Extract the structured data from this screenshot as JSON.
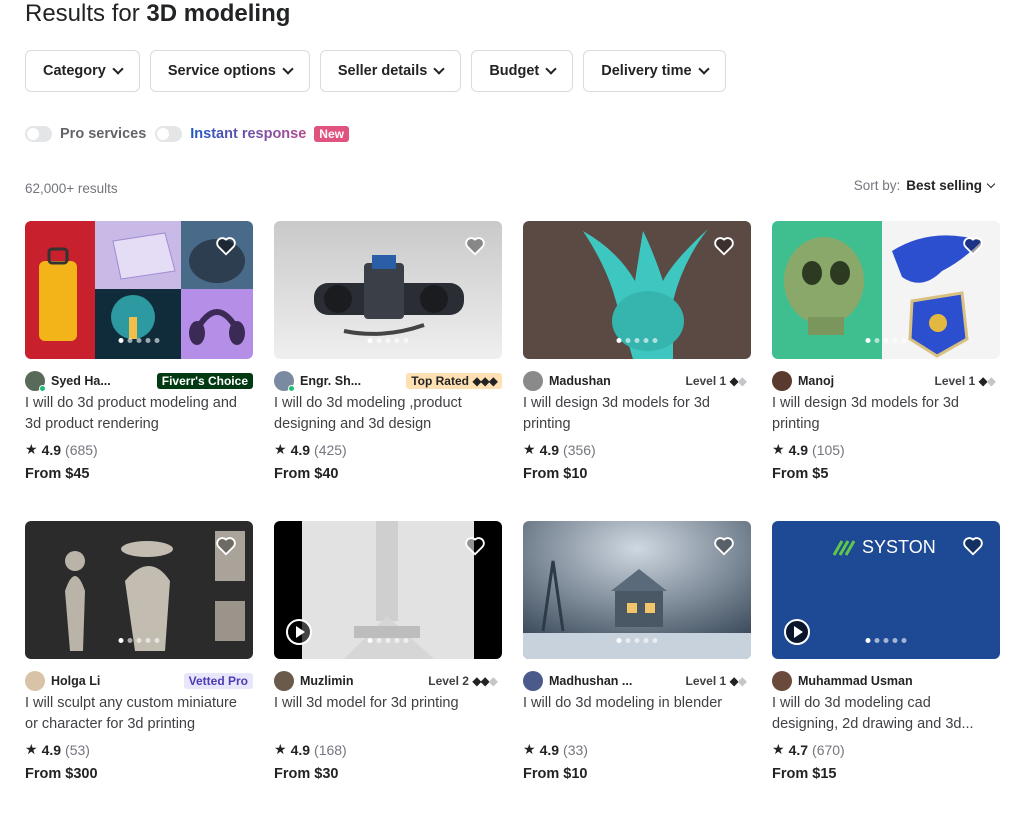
{
  "header": {
    "prefix": "Results for",
    "query": "3D modeling"
  },
  "filters": [
    "Category",
    "Service options",
    "Seller details",
    "Budget",
    "Delivery time"
  ],
  "toggles": {
    "pro": "Pro services",
    "instant": "Instant response",
    "new_badge": "New"
  },
  "results_count": "62,000+ results",
  "sort": {
    "label": "Sort by:",
    "value": "Best selling"
  },
  "gigs": [
    {
      "seller": "Syed Ha...",
      "badge": "Fiverr's Choice",
      "title": "I will do 3d product modeling and 3d product rendering",
      "rating": "4.9",
      "reviews": "(685)",
      "price": "From $45"
    },
    {
      "seller": "Engr. Sh...",
      "badge": "Top Rated",
      "title": "I will do 3d modeling ,product designing and 3d design",
      "rating": "4.9",
      "reviews": "(425)",
      "price": "From $40"
    },
    {
      "seller": "Madushan",
      "badge": "Level 1",
      "title": "I will design 3d models for 3d printing",
      "rating": "4.9",
      "reviews": "(356)",
      "price": "From $10"
    },
    {
      "seller": "Manoj",
      "badge": "Level 1",
      "title": "I will design 3d models for 3d printing",
      "rating": "4.9",
      "reviews": "(105)",
      "price": "From $5"
    },
    {
      "seller": "Holga Li",
      "badge": "Vetted Pro",
      "title": "I will sculpt any custom miniature or character for 3d printing",
      "rating": "4.9",
      "reviews": "(53)",
      "price": "From $300"
    },
    {
      "seller": "Muzlimin",
      "badge": "Level 2",
      "title": "I will 3d model for 3d printing",
      "rating": "4.9",
      "reviews": "(168)",
      "price": "From $30"
    },
    {
      "seller": "Madhushan ...",
      "badge": "Level 1",
      "title": "I will do 3d modeling in blender",
      "rating": "4.9",
      "reviews": "(33)",
      "price": "From $10"
    },
    {
      "seller": "Muhammad Usman",
      "badge": "",
      "title": "I will do 3d modeling cad designing, 2d drawing and 3d...",
      "rating": "4.7",
      "reviews": "(670)",
      "price": "From $15"
    }
  ],
  "syston_logo": "SYSTON"
}
